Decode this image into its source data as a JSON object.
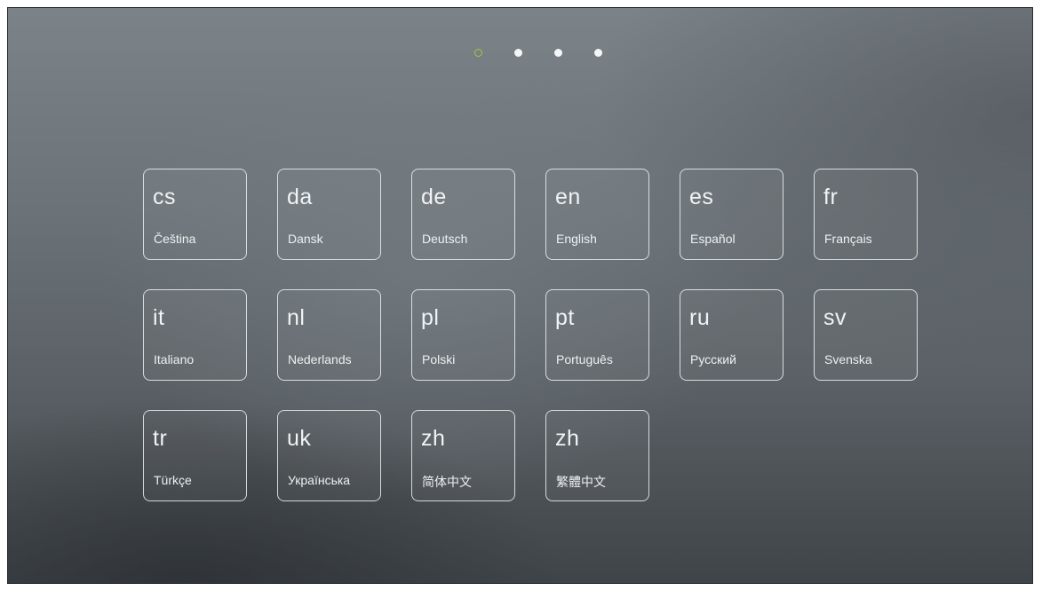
{
  "pager": {
    "page_count": 4,
    "active_index": 0,
    "active_color": "#a8c24a",
    "inactive_color": "#f4f6f7"
  },
  "languages": [
    {
      "code": "cs",
      "name": "Čeština"
    },
    {
      "code": "da",
      "name": "Dansk"
    },
    {
      "code": "de",
      "name": "Deutsch"
    },
    {
      "code": "en",
      "name": "English"
    },
    {
      "code": "es",
      "name": "Español"
    },
    {
      "code": "fr",
      "name": "Français"
    },
    {
      "code": "it",
      "name": "Italiano"
    },
    {
      "code": "nl",
      "name": "Nederlands"
    },
    {
      "code": "pl",
      "name": "Polski"
    },
    {
      "code": "pt",
      "name": "Português"
    },
    {
      "code": "ru",
      "name": "Русский"
    },
    {
      "code": "sv",
      "name": "Svenska"
    },
    {
      "code": "tr",
      "name": "Türkçe"
    },
    {
      "code": "uk",
      "name": "Українська"
    },
    {
      "code": "zh",
      "name": "简体中文"
    },
    {
      "code": "zh",
      "name": "繁體中文"
    }
  ]
}
